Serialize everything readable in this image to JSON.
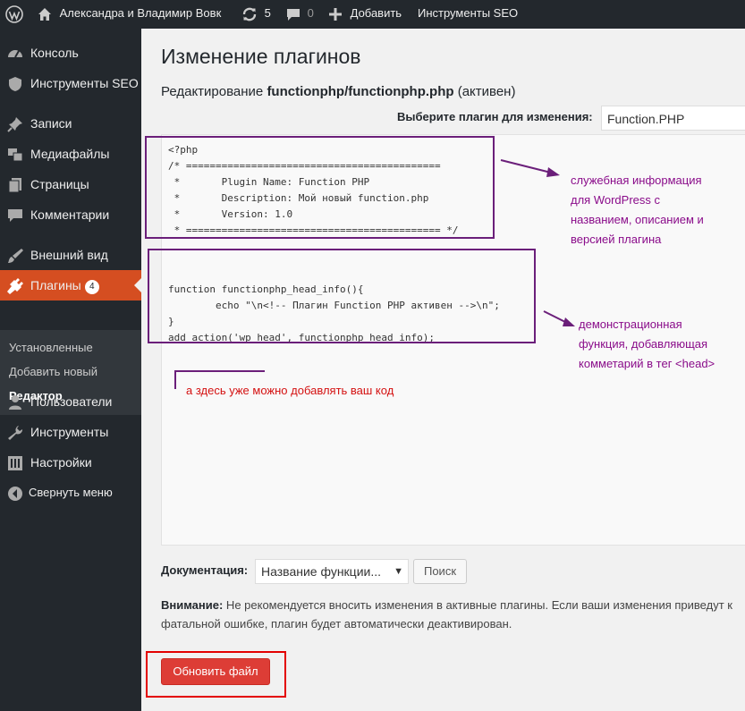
{
  "adminbar": {
    "site_name": "Александра и Владимир Вовк",
    "updates_count": "5",
    "comments_count": "0",
    "add_label": "Добавить",
    "seo_label": "Инструменты SEO"
  },
  "sidebar": {
    "items": [
      {
        "label": "Консоль",
        "icon": "dashboard-icon"
      },
      {
        "label": "Инструменты SEO",
        "icon": "shield-icon"
      },
      {
        "label": "Записи",
        "icon": "pin-icon"
      },
      {
        "label": "Медиафайлы",
        "icon": "media-icon"
      },
      {
        "label": "Страницы",
        "icon": "pages-icon"
      },
      {
        "label": "Комментарии",
        "icon": "comment-icon"
      },
      {
        "label": "Внешний вид",
        "icon": "brush-icon"
      },
      {
        "label": "Плагины",
        "icon": "plugin-icon",
        "badge": "4"
      },
      {
        "label": "Пользователи",
        "icon": "user-icon"
      },
      {
        "label": "Инструменты",
        "icon": "wrench-icon"
      },
      {
        "label": "Настройки",
        "icon": "settings-icon"
      },
      {
        "label": "Свернуть меню",
        "icon": "collapse-icon"
      }
    ],
    "submenu": [
      "Установленные",
      "Добавить новый",
      "Редактор"
    ]
  },
  "main": {
    "title": "Изменение плагинов",
    "subtitle_prefix": "Редактирование",
    "subtitle_file": "functionphp/functionphp.php",
    "subtitle_status": "(активен)",
    "choose_label": "Выберите плагин для изменения:",
    "selected_plugin": "Function.PHP",
    "code_block1": "<?php\n/* ===========================================\n *       Plugin Name: Function PHP\n *       Description: Мой новый function.php\n *       Version: 1.0\n * =========================================== */",
    "code_block2": "function functionphp_head_info(){\n        echo \"\\n<!-- Плагин Function PHP активен -->\\n\";\n}\nadd_action('wp_head', functionphp_head_info);",
    "doc_label": "Документация:",
    "doc_select": "Название функции...",
    "search_button": "Поиск",
    "warning_bold": "Внимание:",
    "warning_text": " Не рекомендуется вносить изменения в активные плагины. Если ваши изменения приведут к фатальной ошибке, плагин будет автоматически деактивирован.",
    "update_button": "Обновить файл"
  },
  "annotations": {
    "note1": "служебная информация\nдля WordPress с\nназванием, описанием и\nверсией плагина",
    "note2": "демонстрационная\nфункция, добавляющая\nкомметарий в тег <head>",
    "note3": "а здесь уже можно добавлять ваш код"
  },
  "colors": {
    "adminbar_bg": "#23282d",
    "active_menu": "#d54e21",
    "annotation_purple": "#6b1f7a",
    "annotation_text": "#8a0c8a",
    "annotation_red": "#d41111",
    "update_button": "#dd3d36"
  }
}
